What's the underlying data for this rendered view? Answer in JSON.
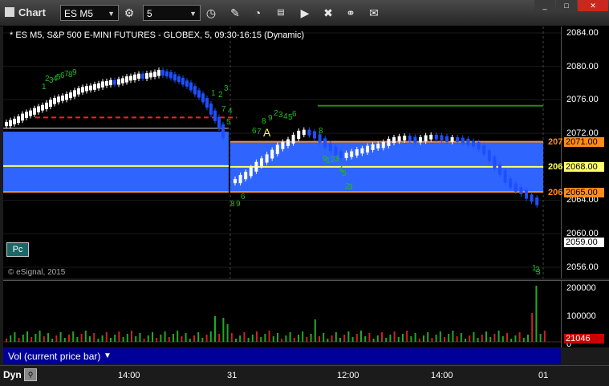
{
  "window": {
    "title": "Chart"
  },
  "toolbar": {
    "symbol": "ES M5",
    "interval": "5",
    "buttons": [
      "settings-icon",
      "clock-icon",
      "pencil-icon",
      "gauge-icon",
      "studies-icon",
      "play-icon",
      "tools-icon",
      "link-icon",
      "comment-icon"
    ]
  },
  "chart": {
    "header": "* ES M5, S&P 500 E-MINI FUTURES - GLOBEX, 5, 09:30-16:15 (Dynamic)",
    "credit": "© eSignal, 2015",
    "pc_button": "Pc",
    "price_ticks": [
      "2084.00",
      "2080.00",
      "2076.00",
      "2072.00",
      "2068.00",
      "2064.00",
      "2060.00",
      "2056.00"
    ],
    "price_tags": [
      {
        "label": "2071.00",
        "color": "#ff8c1a"
      },
      {
        "label": "2068.00",
        "color": "#ffff66"
      },
      {
        "label": "2065.00",
        "color": "#ff8c1a"
      },
      {
        "label": "2059.00",
        "color": "#ffffff"
      }
    ],
    "side_labels": [
      "207",
      "206",
      "206"
    ],
    "annotation": "A",
    "tdcount_labels": [
      "1",
      "2",
      "3",
      "4",
      "5",
      "6",
      "7",
      "8",
      "9",
      "1",
      "2",
      "3",
      "4",
      "5",
      "6",
      "7",
      "8",
      "9",
      "2",
      "3",
      "4",
      "5",
      "6",
      "7",
      "8",
      "9",
      "6",
      "8",
      "9",
      "1",
      "2",
      "3",
      "4",
      "5",
      "2",
      "3",
      "1",
      "2",
      "3",
      "4",
      "5",
      "6",
      "7",
      "8",
      "9"
    ],
    "x_ticks": [
      "14:00",
      "31",
      "12:00",
      "14:00",
      "01"
    ]
  },
  "volume": {
    "label": "Vol (current price bar)",
    "ticks": [
      "200000",
      "100000",
      "0"
    ],
    "current_value": "21046",
    "current_color": "#cc0000"
  },
  "footer": {
    "mode": "Dyn"
  },
  "colors": {
    "band": "#2f64ff",
    "up": "#ffffff",
    "down": "#1d4fff",
    "orange": "#ff8c1a",
    "yellow": "#ffff66",
    "green": "#1e8a1e",
    "red": "#ff2020"
  }
}
